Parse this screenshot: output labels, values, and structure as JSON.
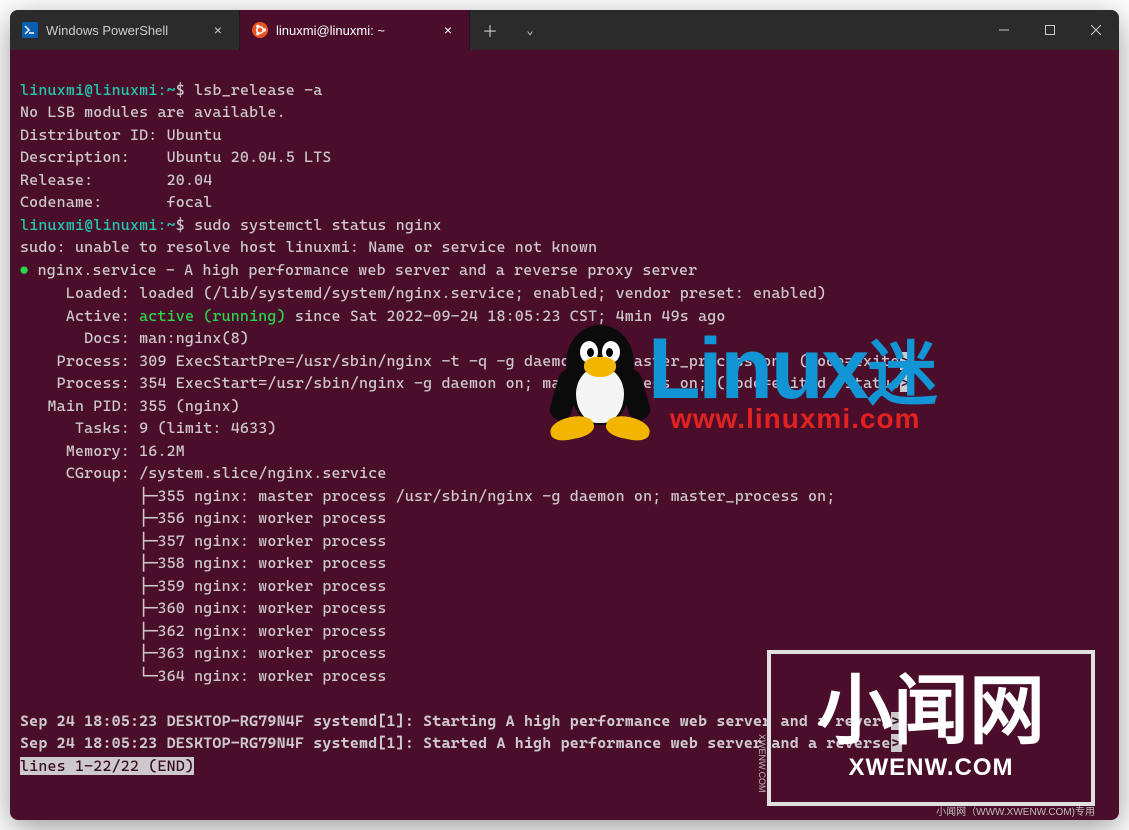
{
  "tabs": [
    {
      "label": "Windows PowerShell",
      "icon_color": "#0a5eb0",
      "active": false
    },
    {
      "label": "linuxmi@linuxmi: ~",
      "icon_color": "#e95420",
      "active": true
    }
  ],
  "window_controls": {
    "minimize": "minimize",
    "maximize": "maximize",
    "close": "close"
  },
  "prompt_user": "linuxmi@linuxmi",
  "prompt_path": "~",
  "prompt_symbol": "$",
  "commands": {
    "cmd1": "lsb_release -a",
    "cmd2": "sudo systemctl status nginx"
  },
  "lsb": {
    "no_modules": "No LSB modules are available.",
    "distributor_id_label": "Distributor ID:",
    "distributor_id": "Ubuntu",
    "description_label": "Description:",
    "description": "Ubuntu 20.04.5 LTS",
    "release_label": "Release:",
    "release": "20.04",
    "codename_label": "Codename:",
    "codename": "focal"
  },
  "sudo_warn": "sudo: unable to resolve host linuxmi: Name or service not known",
  "nginx": {
    "service_line": "nginx.service - A high performance web server and a reverse proxy server",
    "loaded": "     Loaded: loaded (/lib/systemd/system/nginx.service; enabled; vendor preset: enabled)",
    "active_prefix": "     Active: ",
    "active_status": "active (running)",
    "active_suffix": " since Sat 2022-09-24 18:05:23 CST; 4min 49s ago",
    "docs": "       Docs: man:nginx(8)",
    "process1": "    Process: 309 ExecStartPre=/usr/sbin/nginx -t -q -g daemon on; master_process on; (code=exite",
    "process2": "    Process: 354 ExecStart=/usr/sbin/nginx -g daemon on; master_process on; (code=exited, status",
    "main_pid": "   Main PID: 355 (nginx)",
    "tasks": "      Tasks: 9 (limit: 4633)",
    "memory": "     Memory: 16.2M",
    "cgroup": "     CGroup: /system.slice/nginx.service",
    "tree": [
      "             ├─355 nginx: master process /usr/sbin/nginx -g daemon on; master_process on;",
      "             ├─356 nginx: worker process",
      "             ├─357 nginx: worker process",
      "             ├─358 nginx: worker process",
      "             ├─359 nginx: worker process",
      "             ├─360 nginx: worker process",
      "             ├─362 nginx: worker process",
      "             ├─363 nginx: worker process",
      "             └─364 nginx: worker process"
    ],
    "log1": "Sep 24 18:05:23 DESKTOP-RG79N4F systemd[1]: Starting A high performance web server and a revers",
    "log2": "Sep 24 18:05:23 DESKTOP-RG79N4F systemd[1]: Started A high performance web server and a reverse",
    "pager_status": "lines 1-22/22 (END)"
  },
  "watermark1": {
    "text": "Linux",
    "suffix": "迷",
    "url": "www.linuxmi.com"
  },
  "watermark2": {
    "cn": "小闻网",
    "en": "XWENW.COM",
    "foot": "小闻网（WWW.XWENW.COM)专用",
    "side": "XWENW.COM"
  }
}
